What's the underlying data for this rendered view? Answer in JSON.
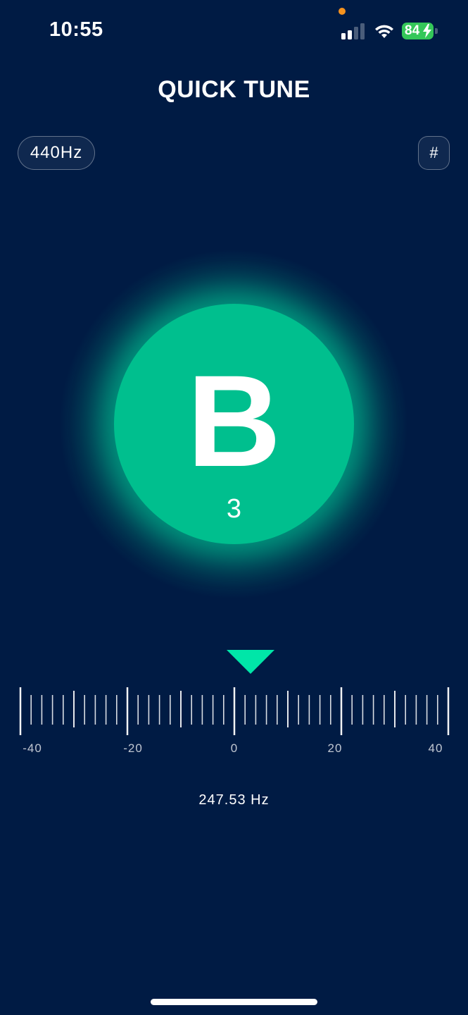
{
  "status_bar": {
    "time": "10:55",
    "battery_percent": "84",
    "signal_bars_active": 2,
    "signal_bars_total": 4,
    "charging": true
  },
  "header": {
    "title": "QUICK TUNE"
  },
  "controls": {
    "reference_frequency": "440Hz",
    "accidental_toggle": "#"
  },
  "note_display": {
    "note": "B",
    "octave": "3"
  },
  "cents_meter": {
    "labels": [
      "-40",
      "-20",
      "0",
      "20",
      "40"
    ],
    "min": -40,
    "max": 40
  },
  "frequency_readout": "247.53 Hz",
  "colors": {
    "background": "#001b44",
    "accent": "#00bf8e",
    "pointer": "#00e6a8",
    "battery": "#34c759",
    "privacy_dot": "#f7931e"
  }
}
